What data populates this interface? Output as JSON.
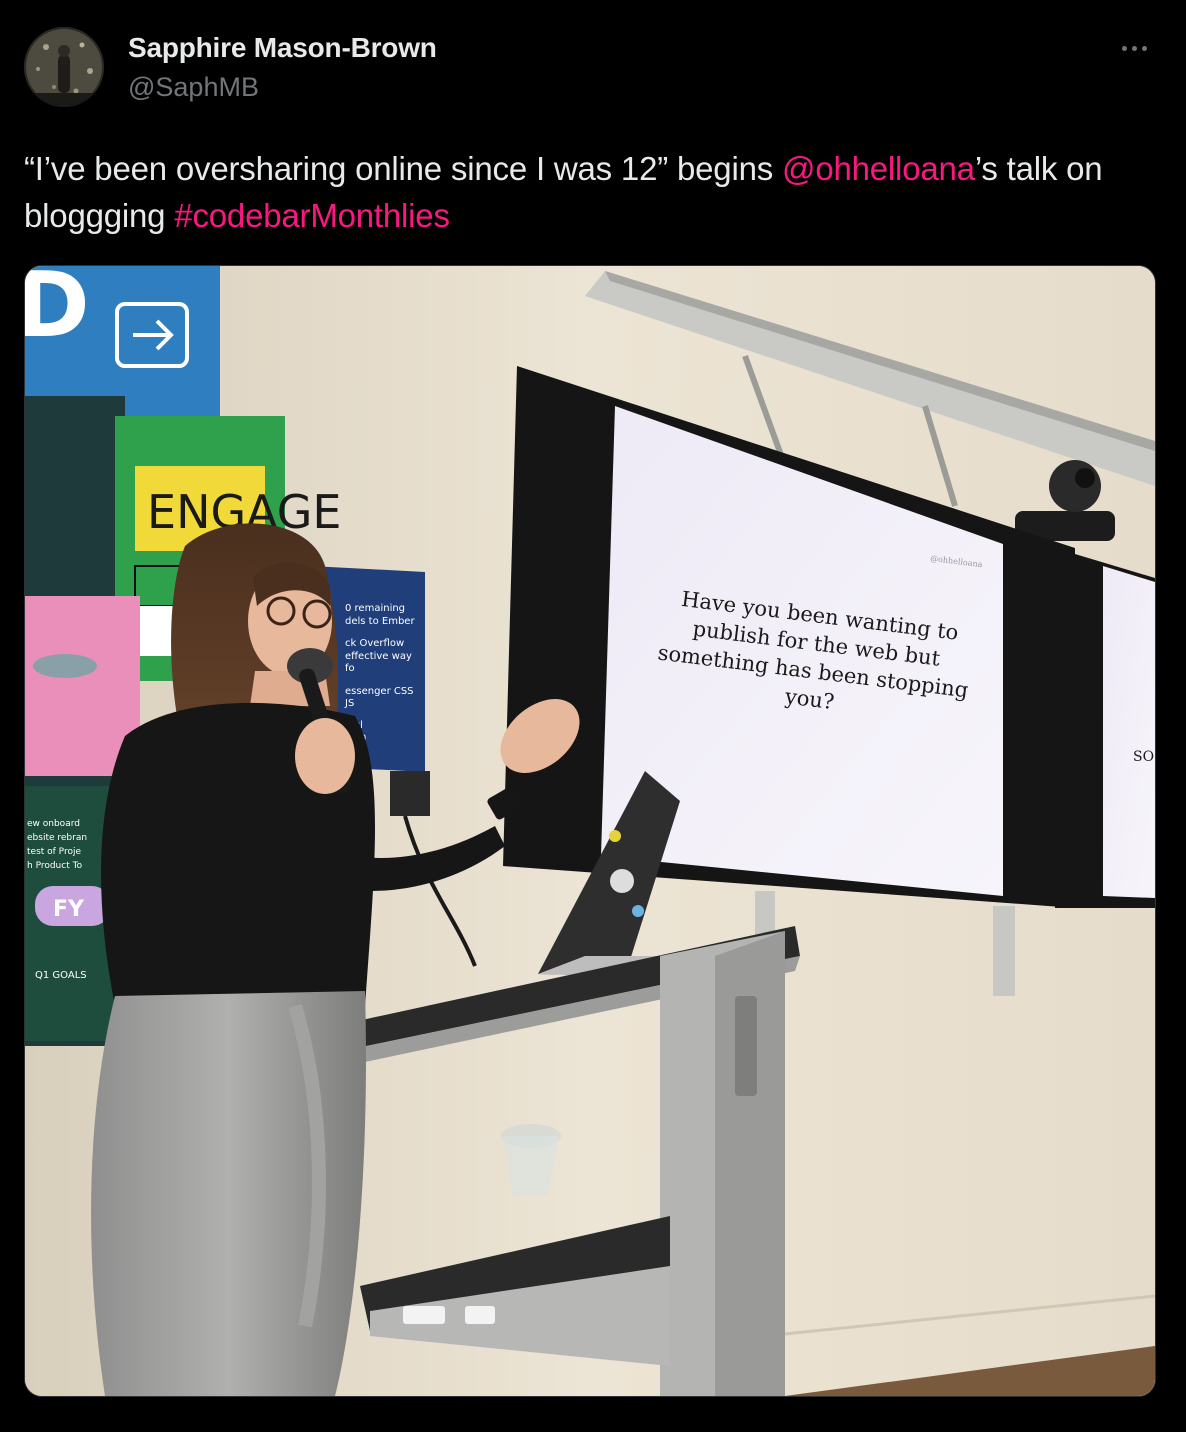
{
  "author": {
    "display_name": "Sapphire Mason-Brown",
    "handle": "@SaphMB"
  },
  "tweet": {
    "text_before": "“I’ve been oversharing online since I was 12” begins ",
    "mention": "@ohhelloana",
    "text_middle": "’s talk on bloggging ",
    "hashtag": "#codebarMonthlies"
  },
  "colors": {
    "link": "#f91880",
    "text": "#e7e9ea",
    "secondary": "#71767b",
    "background": "#000000"
  },
  "icons": {
    "more": "more-horizontal-icon"
  },
  "photo": {
    "slide": {
      "watermark": "@ohhelloana",
      "line1": "Have you been wanting to",
      "line2": "publish for the web but",
      "line3": "something has been stopping",
      "line4": "you?"
    },
    "poster_engage": "ENGAGE",
    "poster_list": [
      "0 remaining",
      "dels to Ember",
      "ck Overflow",
      "effective way",
      "fo",
      "essenger CSS",
      "JS",
      "sful",
      "com"
    ],
    "board_lines": [
      "ew onboard",
      "ebsite rebran",
      "test of Proje",
      "h Product To"
    ],
    "board_fy": "FY",
    "board_goals": "Q1 GOALS",
    "second_screen_text": "SO"
  }
}
